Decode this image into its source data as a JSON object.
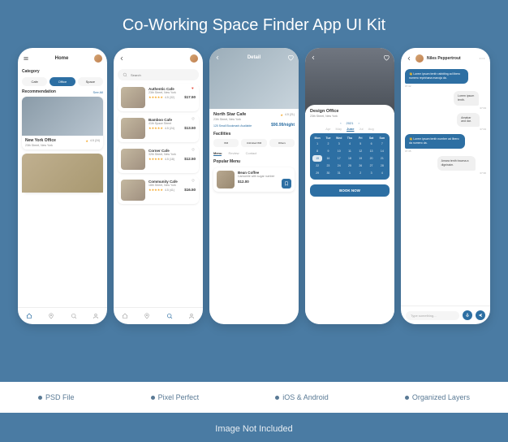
{
  "title": "Co-Working Space Finder App UI Kit",
  "features": [
    "PSD File",
    "Pixel Perfect",
    "iOS & Android",
    "Organized Layers"
  ],
  "not_included": "Image Not Included",
  "screen1": {
    "header": "Home",
    "category_label": "Category",
    "categories": [
      "Cafe",
      "Office",
      "Space"
    ],
    "rec_label": "Recommendation",
    "see_all": "See All",
    "card": {
      "title": "New York Office",
      "address": "23th Street, New York",
      "rating": "4.5 (24)"
    }
  },
  "screen2": {
    "search_placeholder": "Search",
    "items": [
      {
        "title": "Authentic Cafe",
        "sub": "23th Street, New York",
        "rating": "4.5 (32)",
        "price": "$17.50",
        "fav": true
      },
      {
        "title": "Bamboo Cafe",
        "sub": "41th Space Street",
        "rating": "4.5 (24)",
        "price": "$13.50",
        "fav": false
      },
      {
        "title": "Corner Cafe",
        "sub": "32th Street, New York",
        "rating": "4.5 (18)",
        "price": "$12.50",
        "fav": false
      },
      {
        "title": "Community Cafe",
        "sub": "18th Street, New York",
        "rating": "4.5 (41)",
        "price": "$16.50",
        "fav": false
      }
    ]
  },
  "screen3": {
    "header": "Detail",
    "title": "North Star Cafe",
    "address": "23th Street, New York",
    "rating": "4.5 (21)",
    "avail": "120 Small Bookmark Available",
    "price": "$90.99/night",
    "fac_label": "Facilities",
    "facilities": [
      "Wifi",
      "Unlimited Wifi",
      "Others"
    ],
    "tabs": [
      "Menu",
      "Review",
      "Contact"
    ],
    "pop_label": "Popular Menu",
    "pop": {
      "title": "Bean Coffee",
      "sub": "Camomile with sugar number",
      "price": "$12.00"
    }
  },
  "screen4": {
    "title": "Design Office",
    "address": "23th Street, New York",
    "year": "2021",
    "months": [
      "Apr",
      "May",
      "June",
      "Jul",
      "Aug"
    ],
    "days_hdr": [
      "Mon",
      "Tue",
      "Wed",
      "Thu",
      "Fri",
      "Sat",
      "Sun"
    ],
    "book": "BOOK NOW"
  },
  "screen5": {
    "name": "Niles Peppertrout",
    "messages": [
      {
        "who": "them",
        "text": "Lorem ipsum tenth rabbiting ad libero numero repinhana manoja da.",
        "time": "07:32"
      },
      {
        "who": "me",
        "text": "Lorem ipsum tenth.",
        "time": "07:33"
      },
      {
        "who": "me",
        "text": "Amabar and dar.",
        "time": "07:33"
      },
      {
        "who": "them",
        "text": "Lorem ipsum tenth number ad libero da numero da.",
        "time": "07:35"
      },
      {
        "who": "me",
        "text": "Amara tenth trauma a dignissim.",
        "time": "07:36"
      }
    ],
    "input_placeholder": "Type something..."
  }
}
